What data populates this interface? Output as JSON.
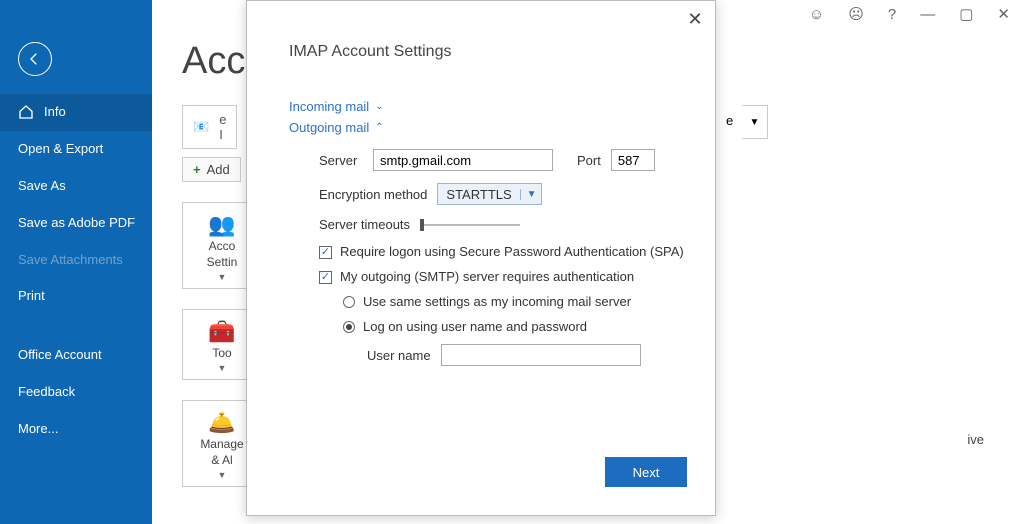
{
  "titlebar": {
    "smile": "☺",
    "frown": "☹",
    "help": "?",
    "min": "—",
    "max": "▢",
    "close": "✕"
  },
  "sidebar": {
    "items": [
      {
        "label": "Info",
        "active": true
      },
      {
        "label": "Open & Export"
      },
      {
        "label": "Save As"
      },
      {
        "label": "Save as Adobe PDF"
      },
      {
        "label": "Save Attachments",
        "disabled": true
      },
      {
        "label": "Print"
      }
    ],
    "footer": [
      {
        "label": "Office Account"
      },
      {
        "label": "Feedback"
      },
      {
        "label": "More..."
      }
    ]
  },
  "main": {
    "title": "Acc",
    "acct_lines": {
      "l1": "e",
      "l2": "I"
    },
    "add_label": "Add",
    "tiles": [
      {
        "label": "Acco\nSettin"
      },
      {
        "label": "Too"
      },
      {
        "label": "Manage\n& Al"
      }
    ],
    "dropdown_suffix": "e",
    "side_word": "ive"
  },
  "modal": {
    "title": "IMAP Account Settings",
    "incoming_label": "Incoming mail",
    "outgoing_label": "Outgoing mail",
    "server_label": "Server",
    "server_value": "smtp.gmail.com",
    "port_label": "Port",
    "port_value": "587",
    "enc_label": "Encryption method",
    "enc_value": "STARTTLS",
    "timeout_label": "Server timeouts",
    "spa_label": "Require logon using Secure Password Authentication (SPA)",
    "smtp_auth_label": "My outgoing (SMTP) server requires authentication",
    "opt_same": "Use same settings as my incoming mail server",
    "opt_logon": "Log on using user name and password",
    "uname_label": "User name",
    "uname_value": "",
    "next": "Next"
  }
}
